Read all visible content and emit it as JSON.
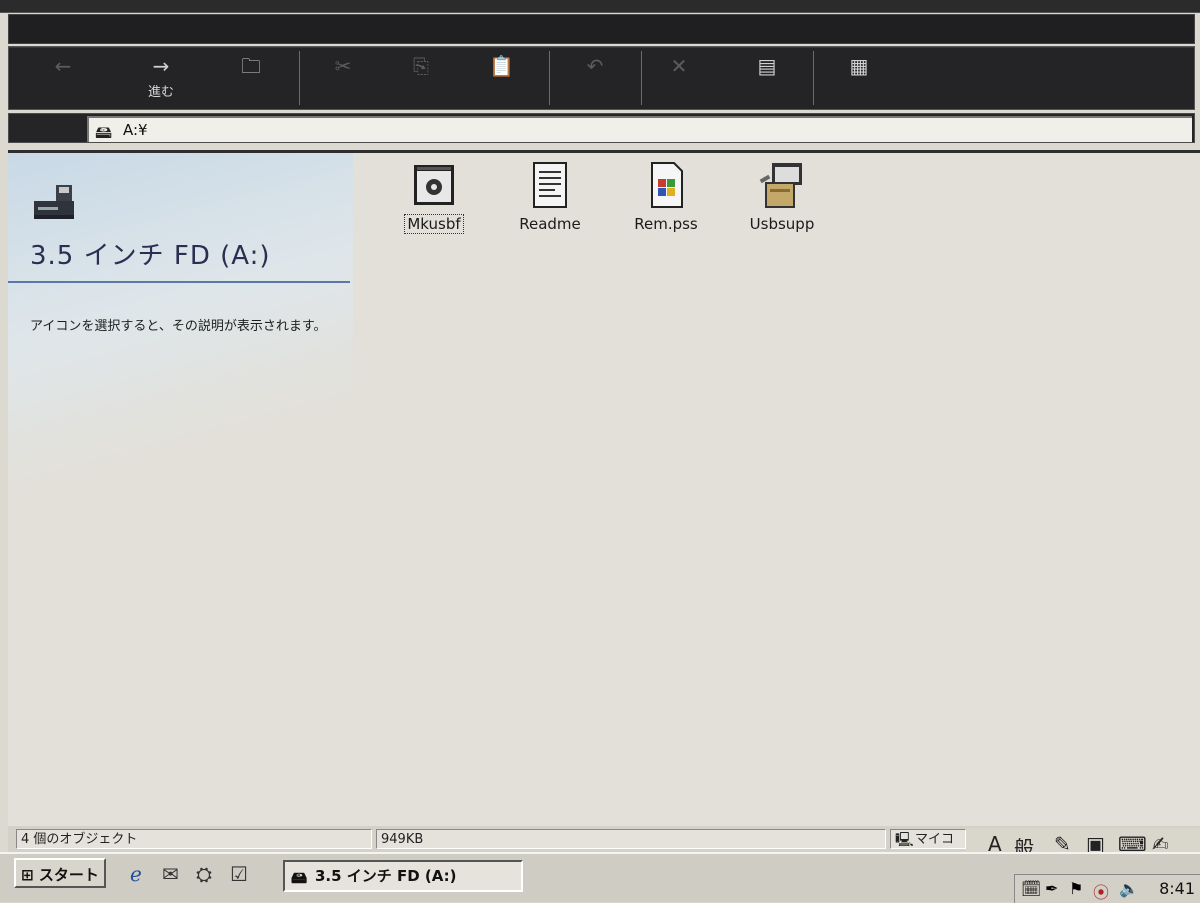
{
  "toolbar": {
    "buttons": [
      {
        "id": "back",
        "icon": "arrow-left-icon",
        "glyph": "←",
        "label": "",
        "disabled": true
      },
      {
        "id": "forward",
        "icon": "arrow-right-icon",
        "glyph": "→",
        "label": "進む",
        "disabled": false
      },
      {
        "id": "up",
        "icon": "folder-up-icon",
        "glyph": "🗀",
        "label": "",
        "disabled": false
      },
      {
        "id": "cut",
        "icon": "scissors-icon",
        "glyph": "✂",
        "label": "",
        "disabled": true
      },
      {
        "id": "copy",
        "icon": "copy-icon",
        "glyph": "⎘",
        "label": "",
        "disabled": true
      },
      {
        "id": "paste",
        "icon": "paste-icon",
        "glyph": "📋",
        "label": "",
        "disabled": true
      },
      {
        "id": "undo",
        "icon": "undo-icon",
        "glyph": "↶",
        "label": "",
        "disabled": true
      },
      {
        "id": "delete",
        "icon": "delete-icon",
        "glyph": "✕",
        "label": "",
        "disabled": true
      },
      {
        "id": "properties",
        "icon": "properties-icon",
        "glyph": "▤",
        "label": "",
        "disabled": false
      },
      {
        "id": "views",
        "icon": "views-icon",
        "glyph": "▦",
        "label": "",
        "disabled": false
      }
    ]
  },
  "address": {
    "path": "A:¥"
  },
  "left_pane": {
    "title": "3.5 インチ FD (A:)",
    "description": "アイコンを選択すると、その説明が表示されます。"
  },
  "files": [
    {
      "name": "Mkusbf",
      "icon": "application-icon",
      "selected": true
    },
    {
      "name": "Readme",
      "icon": "text-document-icon",
      "selected": false
    },
    {
      "name": "Rem.pss",
      "icon": "windows-document-icon",
      "selected": false
    },
    {
      "name": "Usbsupp",
      "icon": "installer-icon",
      "selected": false
    }
  ],
  "status": {
    "objects": "4 個のオブジェクト",
    "size": "949KB",
    "zone": "マイコ"
  },
  "ime": {
    "mode": "A",
    "kanji": "般"
  },
  "taskbar": {
    "start_label": "スタート",
    "task_label": "3.5 インチ FD (A:)",
    "clock": "8:41"
  },
  "colors": {
    "toolbar_bg": "#242426",
    "pane_title": "#2a2f52",
    "pane_rule": "#5b78a6",
    "content_bg": "#e2e0d8"
  }
}
